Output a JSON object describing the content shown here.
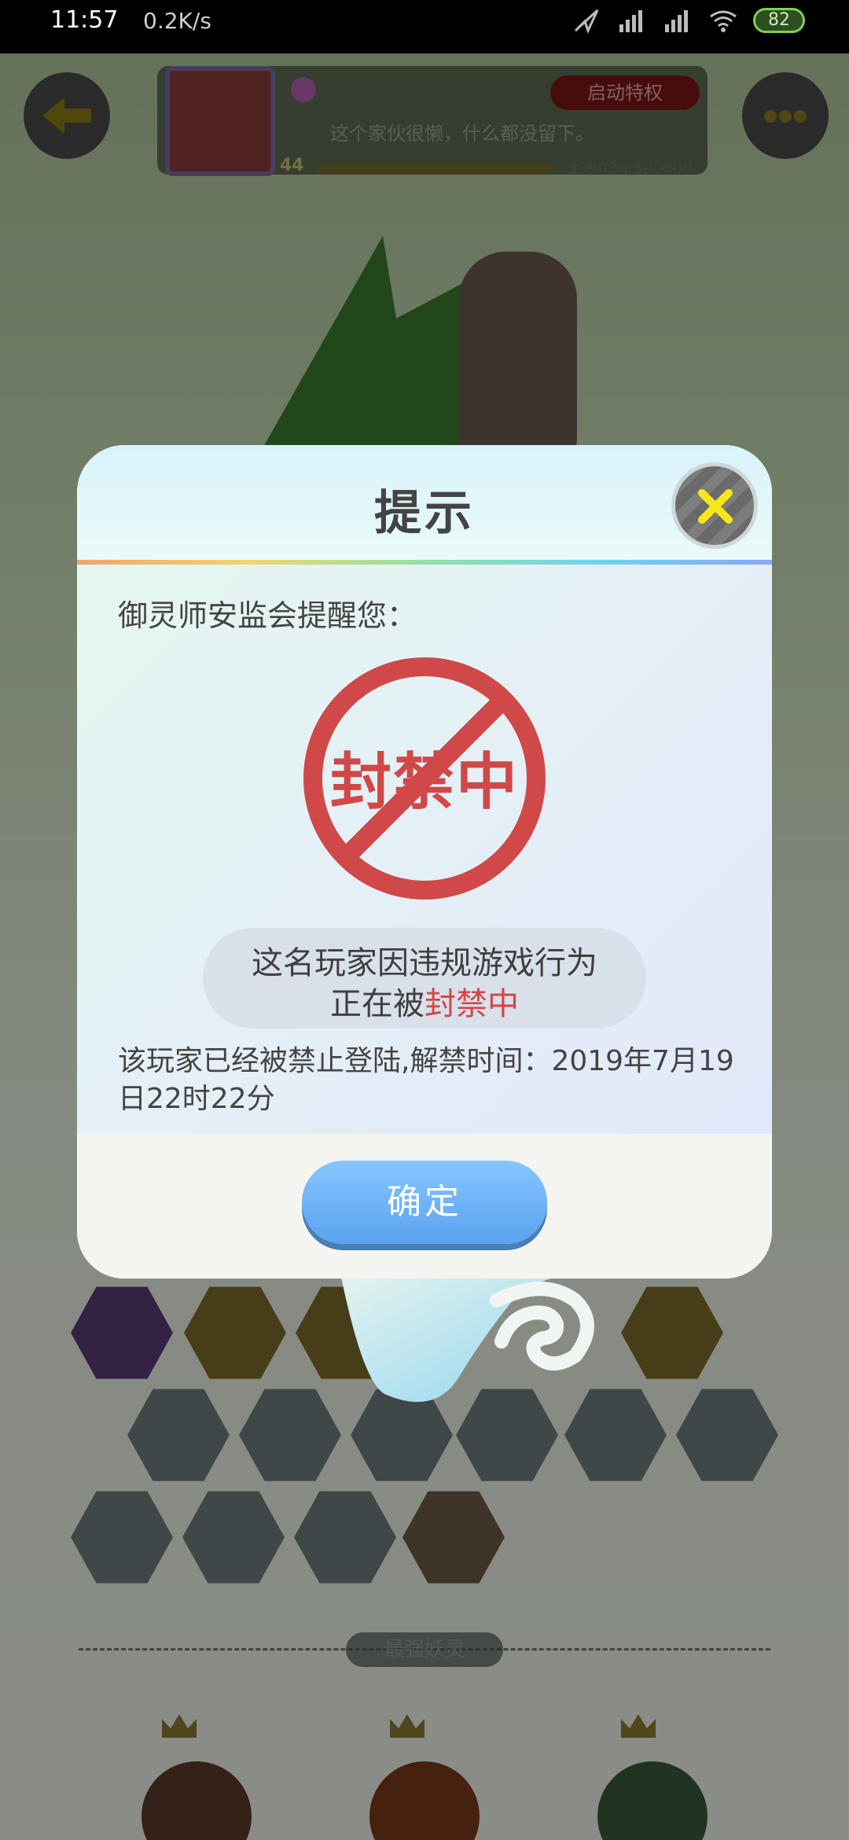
{
  "status_bar": {
    "time": "11:57",
    "speed": "0.2K/s",
    "battery": "82"
  },
  "profile": {
    "privilege_label": "启动特权",
    "motto": "这个家伙很懒，什么都没留下。",
    "level": "44",
    "xp": "359036/590000"
  },
  "bottom": {
    "strongest_label": "最强妖灵"
  },
  "dialog": {
    "title": "提示",
    "reminder": "御灵师安监会提醒您：",
    "ban_stamp": "封禁中",
    "reason_line1": "这名玩家因违规游戏行为",
    "reason_line2_prefix": "正在被",
    "reason_line2_highlight": "封禁中",
    "unban_text": "该玩家已经被禁止登陆,解禁时间：2019年7月19日22时22分",
    "ok_label": "确定"
  },
  "colors": {
    "ban_red": "#d04848",
    "ok_blue": "#5aa2f0",
    "close_x_yellow": "#f5e71b"
  }
}
